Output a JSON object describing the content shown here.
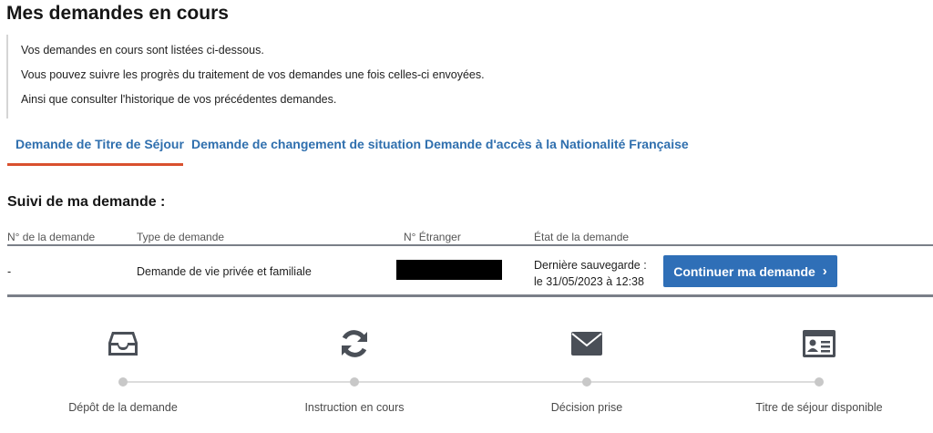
{
  "page": {
    "title": "Mes demandes en cours"
  },
  "info": {
    "lines": [
      "Vos demandes en cours sont listées ci-dessous.",
      "Vous pouvez suivre les progrès du traitement de vos demandes une fois celles-ci envoyées.",
      "Ainsi que consulter l'historique de vos précédentes demandes."
    ]
  },
  "tabs": [
    {
      "label": "Demande de Titre de Séjour",
      "active": true
    },
    {
      "label": "Demande de changement de situation",
      "active": false
    },
    {
      "label": "Demande d'accès à la Nationalité Française",
      "active": false
    }
  ],
  "tracking": {
    "title": "Suivi de ma demande :",
    "columns": [
      "N° de la demande",
      "Type de demande",
      "N° Étranger",
      "État de la demande"
    ],
    "row": {
      "numero": "-",
      "type": "Demande de vie privée et familiale",
      "etranger": "",
      "etat_line1": "Dernière sauvegarde :",
      "etat_line2": "le 31/05/2023 à 12:38"
    },
    "continue_label": "Continuer ma demande",
    "continue_chevron": "›"
  },
  "steps": [
    {
      "label": "Dépôt de la demande",
      "icon": "inbox-icon"
    },
    {
      "label": "Instruction en cours",
      "icon": "refresh-icon"
    },
    {
      "label": "Décision prise",
      "icon": "envelope-icon"
    },
    {
      "label": "Titre de séjour disponible",
      "icon": "id-card-icon"
    }
  ],
  "colors": {
    "accent": "#2f6fae",
    "button": "#2f6fb7",
    "tab_underline": "#d9502e",
    "icon": "#4a4f57"
  }
}
